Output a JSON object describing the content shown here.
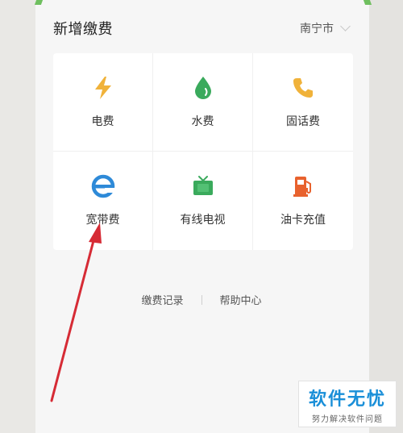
{
  "section": {
    "title": "新增缴费"
  },
  "city": {
    "label": "南宁市",
    "icon": "chevron-down-icon"
  },
  "services": [
    {
      "label": "电费",
      "icon": "lightning-icon",
      "color": "#f0b23a"
    },
    {
      "label": "水费",
      "icon": "water-drop-icon",
      "color": "#3aaa5c"
    },
    {
      "label": "固话费",
      "icon": "phone-icon",
      "color": "#f0b23a"
    },
    {
      "label": "宽带费",
      "icon": "browser-e-icon",
      "color": "#2e8ad8"
    },
    {
      "label": "有线电视",
      "icon": "tv-icon",
      "color": "#3aaa5c"
    },
    {
      "label": "油卡充值",
      "icon": "fuel-pump-icon",
      "color": "#e8622e"
    }
  ],
  "links": {
    "records": "缴费记录",
    "help": "帮助中心"
  },
  "watermark": {
    "title": "软件无忧",
    "subtitle": "努力解决软件问题"
  },
  "annotation": {
    "arrow_color": "#d62b35"
  }
}
